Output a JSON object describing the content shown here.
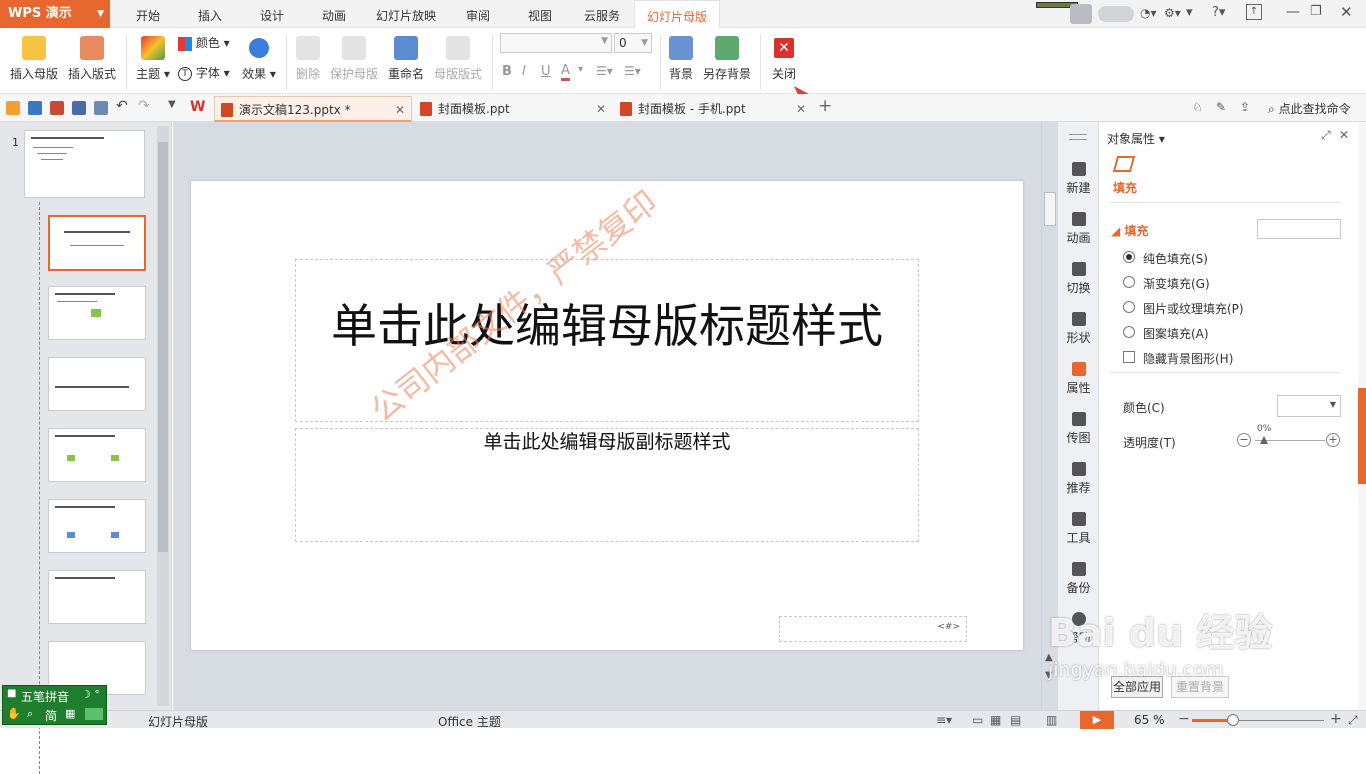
{
  "app": {
    "logo": "WPS 演示"
  },
  "menu": {
    "tabs": [
      "开始",
      "插入",
      "设计",
      "动画",
      "幻灯片放映",
      "审阅",
      "视图",
      "云服务",
      "幻灯片母版"
    ],
    "active_index": 8
  },
  "ribbon": {
    "insert_master": "插入母版",
    "insert_layout": "插入版式",
    "theme": "主题",
    "color": "颜色",
    "font": "字体",
    "effect": "效果",
    "delete": "删除",
    "protect_master": "保护母版",
    "rename": "重命名",
    "master_layout": "母版版式",
    "font_size_value": "0",
    "background": "背景",
    "save_background": "另存背景",
    "close": "关闭"
  },
  "doc_tabs": [
    {
      "label": "演示文稿123.pptx *"
    },
    {
      "label": "封面模板.ppt"
    },
    {
      "label": "封面模板 - 手机.ppt"
    }
  ],
  "search": {
    "label": "点此查找命令"
  },
  "thumbnails": {
    "first_number": "1"
  },
  "slide": {
    "title": "单击此处编辑母版标题样式",
    "subtitle": "单击此处编辑母版副标题样式",
    "page_number_placeholder": "<#>",
    "watermark": "公司内部文件，严禁复印"
  },
  "tools": [
    "新建",
    "动画",
    "切换",
    "形状",
    "属性",
    "传图",
    "推荐",
    "工具",
    "备份",
    "帮助"
  ],
  "properties": {
    "header": "对象属性",
    "tab": "填充",
    "section": "填充",
    "options": [
      "纯色填充(S)",
      "渐变填充(G)",
      "图片或纹理填充(P)",
      "图案填充(A)"
    ],
    "hide_bg_label": "隐藏背景图形(H)",
    "color_label": "颜色(C)",
    "transparency_label": "透明度(T)",
    "transparency_value": "0%",
    "apply_all": "全部应用",
    "reset_bg": "重置背景"
  },
  "status": {
    "mode": "幻灯片母版",
    "theme": "Office 主题",
    "zoom": "65 %"
  },
  "ime": {
    "label": "五笔拼音",
    "mode": "简"
  },
  "baidu_watermark": {
    "brand": "Bai du 经验",
    "url": "jingyan.baidu.com"
  },
  "colors": {
    "accent": "#e8672e",
    "close_red": "#d9322b",
    "annotation_arrow": "#e8363a"
  }
}
